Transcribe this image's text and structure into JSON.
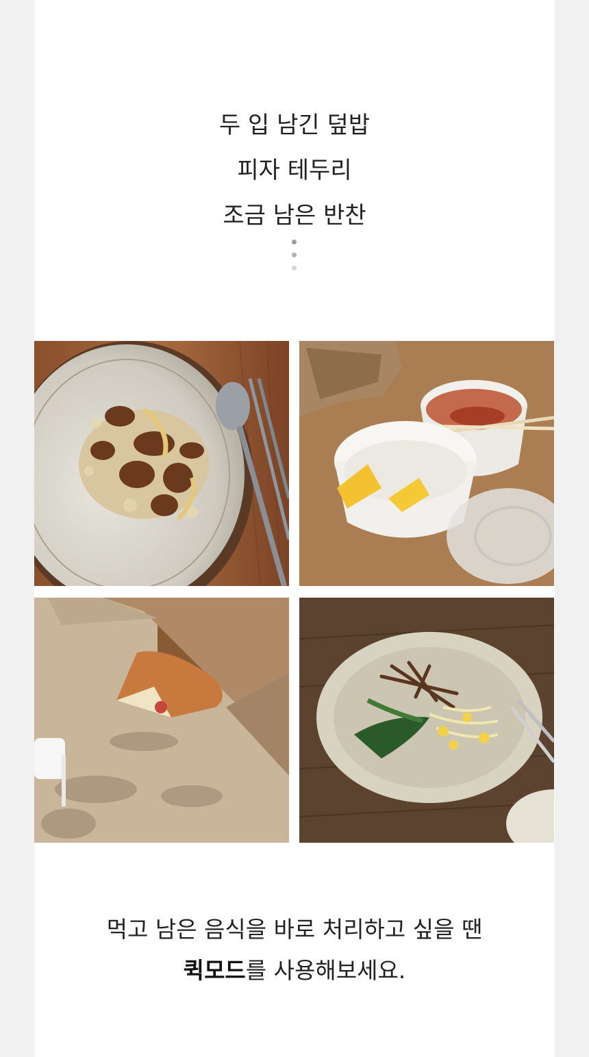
{
  "intro": {
    "line1": "두 입 남긴 덮밥",
    "line2": "피자 테두리",
    "line3": "조금 남은 반찬"
  },
  "photos": [
    {
      "name": "leftover-rice-bowl-photo"
    },
    {
      "name": "leftover-side-dish-cups-photo"
    },
    {
      "name": "pizza-crust-box-photo"
    },
    {
      "name": "leftover-namul-plate-photo"
    }
  ],
  "outro": {
    "line1": "먹고 남은 음식을 바로 처리하고 싶을 땐",
    "highlight": "퀵모드",
    "line2_rest": "를 사용해보세요."
  },
  "colors": {
    "page_bg": "#ffffff",
    "outer_bg": "#f1f1f1",
    "text": "#222222"
  }
}
